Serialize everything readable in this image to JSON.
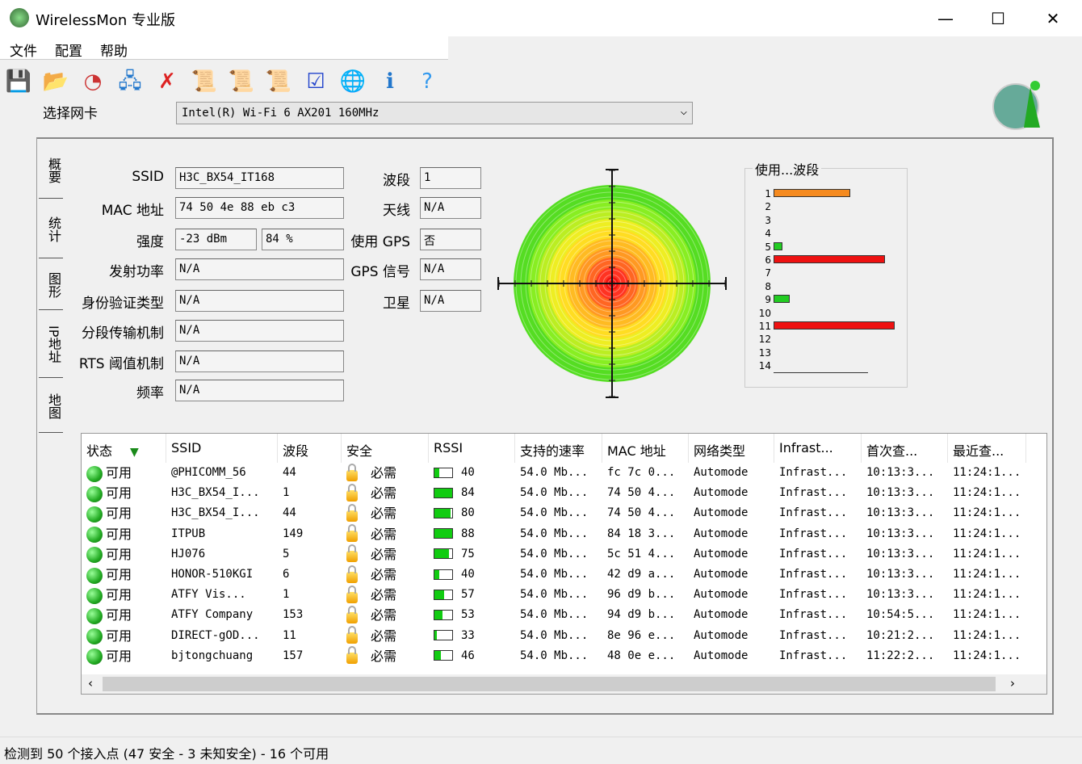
{
  "window": {
    "title": "WirelessMon 专业版",
    "minimize": "—",
    "maximize": "☐",
    "close": "✕"
  },
  "menu": [
    "文件",
    "配置",
    "帮助"
  ],
  "toolbar": [
    {
      "icon": "save-icon",
      "glyph": "💾"
    },
    {
      "icon": "open-folder-icon",
      "glyph": "📂"
    },
    {
      "icon": "speedometer-icon",
      "glyph": "◔"
    },
    {
      "icon": "network-connect-icon",
      "glyph": "🖧"
    },
    {
      "icon": "network-disconnect-icon",
      "glyph": "✗"
    },
    {
      "icon": "log-start-icon",
      "glyph": "📜"
    },
    {
      "icon": "log-stop-icon",
      "glyph": "📜"
    },
    {
      "icon": "log-check-icon",
      "glyph": "📜"
    },
    {
      "icon": "checklist-icon",
      "glyph": "☑"
    },
    {
      "icon": "globe-icon",
      "glyph": "🌐"
    },
    {
      "icon": "info-icon",
      "glyph": "ℹ"
    },
    {
      "icon": "help-icon",
      "glyph": "?"
    }
  ],
  "nic": {
    "label": "选择网卡",
    "value": "Intel(R) Wi-Fi 6 AX201 160MHz"
  },
  "side_tabs": [
    "概要",
    "统计",
    "图形",
    "IP地址",
    "地图"
  ],
  "summary": {
    "fields": [
      {
        "label": "SSID",
        "value": "H3C_BX54_IT168"
      },
      {
        "label": "MAC 地址",
        "value": "74 50 4e 88 eb c3"
      },
      {
        "label": "强度",
        "value": "-23 dBm",
        "value2": "84 %"
      },
      {
        "label": "发射功率",
        "value": "N/A"
      },
      {
        "label": "身份验证类型",
        "value": "N/A"
      },
      {
        "label": "分段传输机制",
        "value": "N/A"
      },
      {
        "label": "RTS 阈值机制",
        "value": "N/A"
      },
      {
        "label": "频率",
        "value": "N/A"
      }
    ],
    "right_fields": [
      {
        "label": "波段",
        "value": "1"
      },
      {
        "label": "天线",
        "value": "N/A"
      },
      {
        "label": "使用 GPS",
        "value": "否"
      },
      {
        "label": "GPS 信号",
        "value": "N/A"
      },
      {
        "label": "卫星",
        "value": "N/A"
      }
    ],
    "signal_strength_percent": 84
  },
  "chart_data": {
    "type": "bar",
    "title": "使用...波段",
    "categories": [
      "1",
      "2",
      "3",
      "4",
      "5",
      "6",
      "7",
      "8",
      "9",
      "10",
      "11",
      "12",
      "13",
      "14"
    ],
    "values": [
      0.63,
      0,
      0,
      0,
      0.07,
      0.92,
      0,
      0,
      0.13,
      0,
      1.0,
      0,
      0,
      0
    ],
    "colors": {
      "1": "#f58a1f",
      "5": "#22cc22",
      "6": "#ee1111",
      "9": "#22cc22",
      "11": "#ee1111"
    },
    "orientation": "horizontal"
  },
  "table": {
    "sort_icon": "sort-down-triangle-icon",
    "columns": [
      "状态",
      "SSID",
      "波段",
      "安全",
      "RSSI",
      "支持的速率",
      "MAC 地址",
      "网络类型",
      "Infrast...",
      "首次查...",
      "最近查..."
    ],
    "rows": [
      [
        "可用",
        "@PHICOMM_56",
        "44",
        "必需",
        "40",
        "54.0 Mb...",
        "fc 7c 0...",
        "Automode",
        "Infrast...",
        "10:13:3...",
        "11:24:1..."
      ],
      [
        "可用",
        "H3C_BX54_I...",
        "1",
        "必需",
        "84",
        "54.0 Mb...",
        "74 50 4...",
        "Automode",
        "Infrast...",
        "10:13:3...",
        "11:24:1..."
      ],
      [
        "可用",
        "H3C_BX54_I...",
        "44",
        "必需",
        "80",
        "54.0 Mb...",
        "74 50 4...",
        "Automode",
        "Infrast...",
        "10:13:3...",
        "11:24:1..."
      ],
      [
        "可用",
        "ITPUB",
        "149",
        "必需",
        "88",
        "54.0 Mb...",
        "84 18 3...",
        "Automode",
        "Infrast...",
        "10:13:3...",
        "11:24:1..."
      ],
      [
        "可用",
        "HJ076",
        "5",
        "必需",
        "75",
        "54.0 Mb...",
        "5c 51 4...",
        "Automode",
        "Infrast...",
        "10:13:3...",
        "11:24:1..."
      ],
      [
        "可用",
        "HONOR-510KGI",
        "6",
        "必需",
        "40",
        "54.0 Mb...",
        "42 d9 a...",
        "Automode",
        "Infrast...",
        "10:13:3...",
        "11:24:1..."
      ],
      [
        "可用",
        "ATFY  Vis...",
        "1",
        "必需",
        "57",
        "54.0 Mb...",
        "96 d9 b...",
        "Automode",
        "Infrast...",
        "10:13:3...",
        "11:24:1..."
      ],
      [
        "可用",
        "ATFY  Company",
        "153",
        "必需",
        "53",
        "54.0 Mb...",
        "94 d9 b...",
        "Automode",
        "Infrast...",
        "10:54:5...",
        "11:24:1..."
      ],
      [
        "可用",
        "DIRECT-gOD...",
        "11",
        "必需",
        "33",
        "54.0 Mb...",
        "8e 96 e...",
        "Automode",
        "Infrast...",
        "10:21:2...",
        "11:24:1..."
      ],
      [
        "可用",
        "bjtongchuang",
        "157",
        "必需",
        "46",
        "54.0 Mb...",
        "48 0e e...",
        "Automode",
        "Infrast...",
        "11:22:2...",
        "11:24:1..."
      ]
    ]
  },
  "status": "检测到 50 个接入点 (47 安全 - 3 未知安全) - 16 个可用"
}
